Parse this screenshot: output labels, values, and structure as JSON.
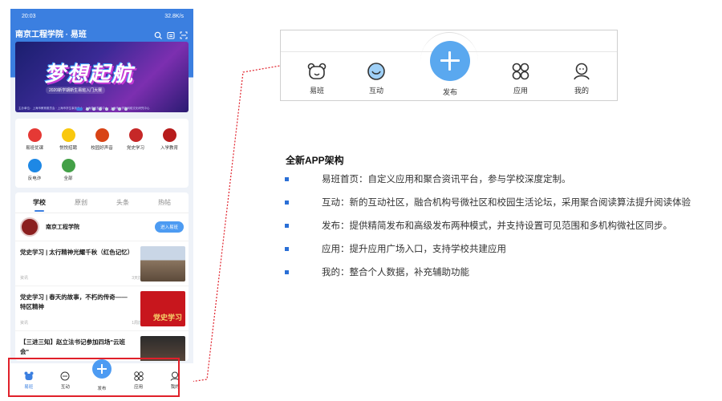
{
  "phone": {
    "status_time": "20:03",
    "status_right": "32.8K/s",
    "title": "南京工程学院 · 易班",
    "banner": {
      "title": "梦想起航",
      "subtitle": "2020新学期新生易班入门大赛",
      "footer": "主办单位：上海市教育委员会 · 上海市学生事务中心 · 上海易班发展中心 · 上海市大学生网络文化研究中心"
    },
    "apps": [
      {
        "label": "易班优课",
        "color": "#e53935"
      },
      {
        "label": "悦悦招聘",
        "color": "#f9c80e"
      },
      {
        "label": "校园好声音",
        "color": "#d84315"
      },
      {
        "label": "党史学习",
        "color": "#c62828"
      },
      {
        "label": "入学教育",
        "color": "#b71c1c"
      },
      {
        "label": "反电诈",
        "color": "#1e88e5"
      },
      {
        "label": "全部",
        "color": "#43a047"
      }
    ],
    "tabs": [
      "学校",
      "原创",
      "头条",
      "热帖"
    ],
    "school_name": "南京工程学院",
    "enter_button": "进入易班",
    "articles": [
      {
        "title": "党史学习 | 太行精神光耀千秋（红色记忆）",
        "source": "资讯",
        "time": "3天前"
      },
      {
        "title": "党史学习 | 春天的故事，不朽的传奇——特区精神",
        "source": "资讯",
        "time": "1周前"
      },
      {
        "title": "【三进三知】赵立法书记参加四场\"云班会\"",
        "source": "",
        "time": ""
      }
    ],
    "thumb_text": "党史学习",
    "tabbar": [
      "易班",
      "互动",
      "发布",
      "应用",
      "我的"
    ]
  },
  "zoom": {
    "items": [
      "易班",
      "互动",
      "发布",
      "应用",
      "我的"
    ]
  },
  "description": {
    "title": "全新APP架构",
    "bullets": [
      "易班首页：自定义应用和聚合资讯平台，参与学校深度定制。",
      "互动：新的互动社区，融合机构号微社区和校园生活论坛，采用聚合阅读算法提升阅读体验",
      "发布：提供精简发布和高级发布两种模式，并支持设置可见范围和多机构微社区同步。",
      "应用：提升应用广场入口，支持学校共建应用",
      "我的：整合个人数据，补充辅助功能"
    ]
  },
  "colors": {
    "brand_blue": "#3b7fe0",
    "highlight_red": "#e0202a",
    "bullet_blue": "#2a6fd6"
  }
}
